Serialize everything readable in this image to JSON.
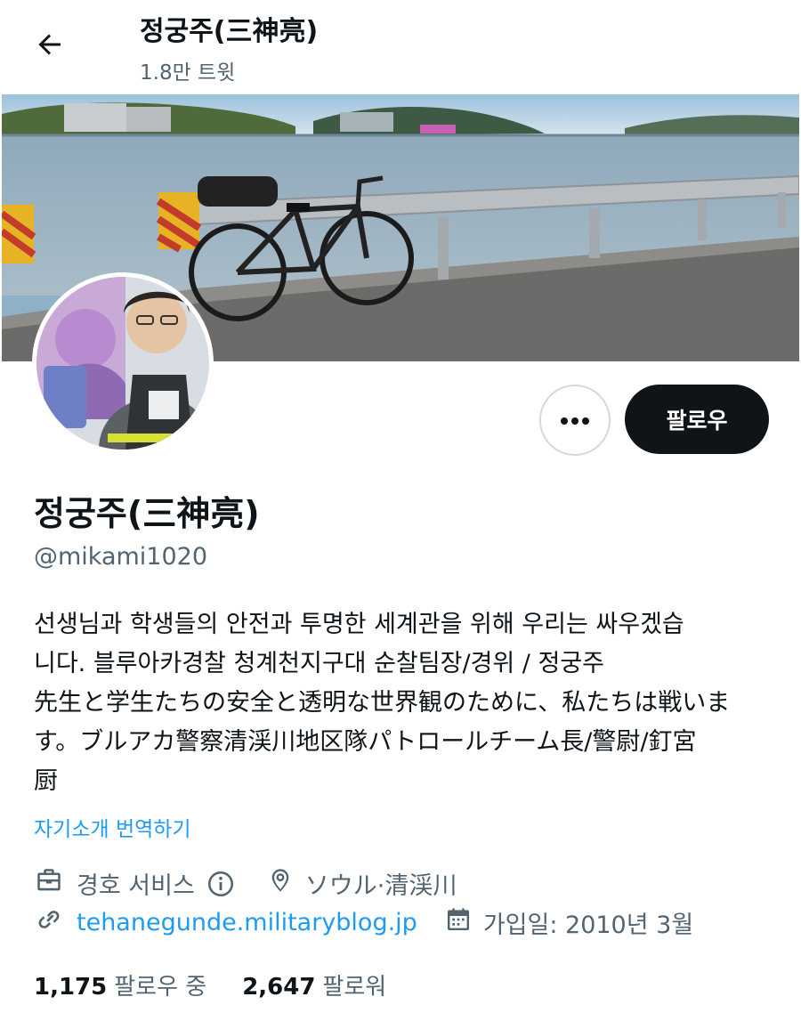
{
  "header": {
    "title": "정궁주(三神亮)",
    "tweet_count": "1.8만 트윗",
    "back_icon": "arrow-left-icon"
  },
  "profile": {
    "display_name": "정궁주(三神亮)",
    "handle": "@mikami1020",
    "follow_label": "팔로우",
    "more_icon": "ellipsis-icon",
    "bio_lines": [
      "선생님과 학생들의 안전과 투명한 세계관을 위해 우리는 싸우겠습",
      "니다. 블루아카경찰 청계천지구대 순찰팀장/경위 / 정궁주",
      "先生と学生たちの安全と透明な世界観のために、私たちは戦いま",
      "す。ブルアカ警察清渓川地区隊パトロールチーム長/警尉/釘宮",
      "厨"
    ],
    "translate_label": "자기소개 번역하기",
    "category": "경호 서비스",
    "location": "ソウル·清渓川",
    "website": "tehanegunde.militaryblog.jp",
    "joined": "가입일: 2010년 3월",
    "following_count": "1,175",
    "following_label": "팔로우 중",
    "followers_count": "2,647",
    "followers_label": "팔로워"
  },
  "colors": {
    "text": "#0f1419",
    "secondary": "#536471",
    "link": "#1d9bf0",
    "follow_bg": "#0f1419"
  }
}
